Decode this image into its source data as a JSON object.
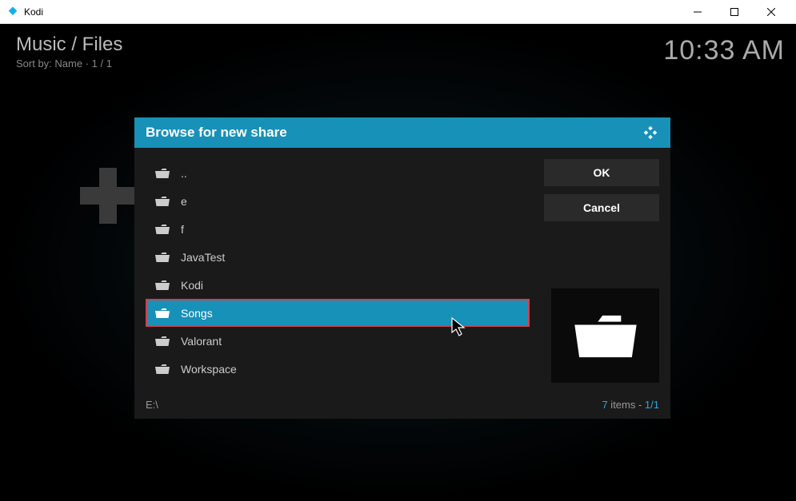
{
  "window": {
    "title": "Kodi"
  },
  "header": {
    "breadcrumb": "Music / Files",
    "sort_label": "Sort by: Name",
    "page": "1 / 1",
    "clock": "10:33 AM"
  },
  "dialog": {
    "title": "Browse for new share",
    "items": [
      {
        "label": "..",
        "selected": false,
        "highlighted": false
      },
      {
        "label": "e",
        "selected": false,
        "highlighted": false
      },
      {
        "label": "f",
        "selected": false,
        "highlighted": false
      },
      {
        "label": "JavaTest",
        "selected": false,
        "highlighted": false
      },
      {
        "label": "Kodi",
        "selected": false,
        "highlighted": false
      },
      {
        "label": "Songs",
        "selected": true,
        "highlighted": true
      },
      {
        "label": "Valorant",
        "selected": false,
        "highlighted": false
      },
      {
        "label": "Workspace",
        "selected": false,
        "highlighted": false
      }
    ],
    "ok_label": "OK",
    "cancel_label": "Cancel",
    "footer_path": "E:\\",
    "footer_count_prefix": "7",
    "footer_count_word": " items - ",
    "footer_count_page": "1/1"
  }
}
